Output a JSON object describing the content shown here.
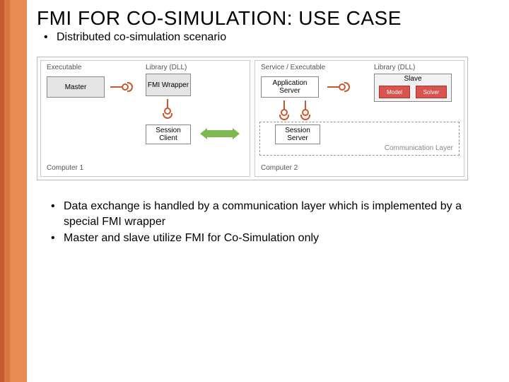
{
  "title": "FMI FOR CO-SIMULATION: USE CASE",
  "sub_bullet": "Distributed co-simulation scenario",
  "diagram": {
    "left": {
      "header_executable": "Executable",
      "header_library": "Library (DLL)",
      "master": "Master",
      "fmi_wrapper": "FMI Wrapper",
      "session_client": "Session Client",
      "footer": "Computer 1"
    },
    "right": {
      "header_service": "Service / Executable",
      "header_library": "Library (DLL)",
      "app_server": "Application Server",
      "session_server": "Session Server",
      "slave_title": "Slave",
      "slave_model": "Model",
      "slave_solver": "Solver",
      "comm_layer": "Communication Layer",
      "footer": "Computer 2"
    }
  },
  "bullets": {
    "b1": "Data exchange is handled by a communication layer which is implemented by a special FMI wrapper",
    "b2": "Master and slave utilize FMI for Co-Simulation only"
  }
}
